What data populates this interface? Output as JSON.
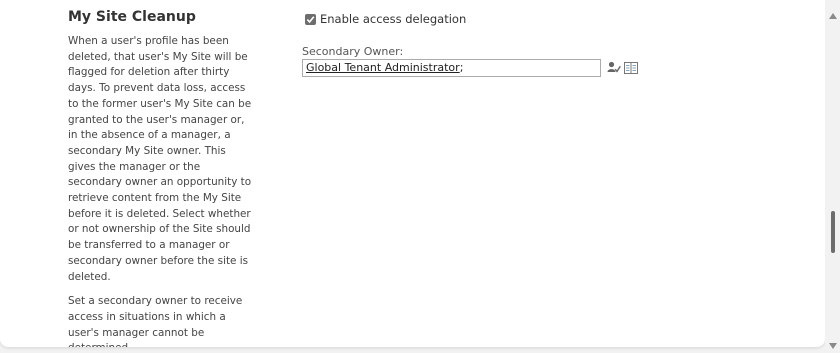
{
  "section": {
    "title": "My Site Cleanup",
    "paragraphs": [
      "When a user's profile has been deleted, that user's My Site will be flagged for deletion after thirty days. To prevent data loss, access to the former user's My Site can be granted to the user's manager or, in the absence of a manager, a secondary My Site owner. This gives the manager or the secondary owner an opportunity to retrieve content from the My Site before it is deleted. Select whether or not ownership of the Site should be transferred to a manager or secondary owner before the site is deleted.",
      "Set a secondary owner to receive access in situations in which a user's manager cannot be determined."
    ]
  },
  "settings": {
    "delegation_label": "Enable access delegation",
    "delegation_checked": true,
    "owner_label": "Secondary Owner:",
    "owner_value": "Global Tenant Administrator",
    "owner_separator": ";"
  },
  "icons": {
    "check_names": "check-names-icon",
    "browse": "address-book-icon"
  },
  "scrollbar": {
    "position_fraction": 0.66
  },
  "colors": {
    "background": "#f2f2f2",
    "panel": "#ffffff",
    "checkbox": "#6d6d6d",
    "input_border": "#ababab"
  }
}
